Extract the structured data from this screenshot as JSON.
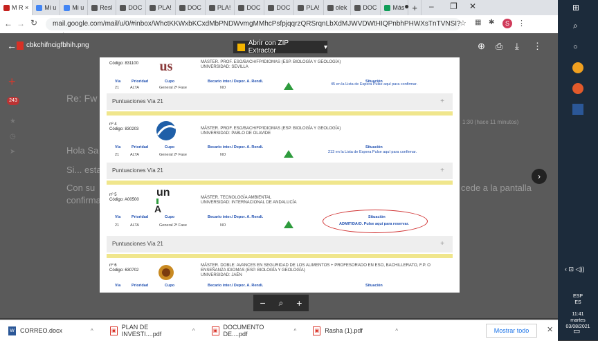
{
  "browser": {
    "tabs": [
      {
        "label": "M R ×",
        "color": "#c5221f"
      },
      {
        "label": "Mi u",
        "color": "#4285f4"
      },
      {
        "label": "Mi u",
        "color": "#4285f4"
      },
      {
        "label": "Resl",
        "color": "#555555"
      },
      {
        "label": "DOC",
        "color": "#555555"
      },
      {
        "label": "PLA!",
        "color": "#555555"
      },
      {
        "label": "DOC",
        "color": "#555555"
      },
      {
        "label": "PLA!",
        "color": "#555555"
      },
      {
        "label": "DOC",
        "color": "#555555"
      },
      {
        "label": "DOC",
        "color": "#555555"
      },
      {
        "label": "PLA!",
        "color": "#555555"
      },
      {
        "label": "olek",
        "color": "#555555"
      },
      {
        "label": "DOC",
        "color": "#555555"
      },
      {
        "label": "Más",
        "color": "#0f9d58"
      }
    ],
    "url": "mail.google.com/mail/u/0/#inbox/WhctKKWxbKCxdMbPNDWvmgMMhcPsfpjqqrzQRSrqnLbXdMJWVDWtHIQPnbhPHWXsTnTVNSI?projector=1"
  },
  "gmail_bg": {
    "subject": "Re: Fw",
    "line1": "Hola Sa",
    "line2": "Si... esta",
    "line3": "Con su",
    "line4": "confirma",
    "right_text": "cede a la pantalla",
    "date_right": "1:30 (hace 11 minutos)"
  },
  "viewer": {
    "filename": "cbkchifncigfbhih.png",
    "zip_button": "Abrir con ZIP Extractor"
  },
  "doc": {
    "entries": [
      {
        "num": "",
        "code": "Código: 831100",
        "title": "MÁSTER. PROF. ESO/BACH/FP/IDIOMAS (ESP. BIOLOGÍA Y GEOLOGÍA)",
        "univ": "UNIVERSIDAD: SEVILLA",
        "via": "21",
        "prioridad": "ALTA",
        "cupo": "General 2ª Fase",
        "becario": "NO",
        "situacion": "45 en la Lista de Espera Pulse aquí para confirmar.",
        "logo": "us"
      },
      {
        "num": "nº 4",
        "code": "Código: 830203",
        "title": "MÁSTER. PROF. ESO/BACH/FP/IDIOMAS (ESP. BIOLOGÍA Y GEOLOGÍA)",
        "univ": "UNIVERSIDAD: PABLO DE OLAVIDE",
        "via": "21",
        "prioridad": "ALTA",
        "cupo": "General 2ª Fase",
        "becario": "NO",
        "situacion": "213 en la Lista de Espera Pulse aquí para confirmar.",
        "logo": "upo"
      },
      {
        "num": "nº 5",
        "code": "Código: A00500",
        "title": "MÁSTER. TECNOLOGÍA AMBIENTAL",
        "univ": "UNIVERSIDAD: INTERNACIONAL DE ANDALUCÍA",
        "via": "21",
        "prioridad": "ALTA",
        "cupo": "General 2ª Fase",
        "becario": "NO",
        "situacion": "ADMITIDA/O. Pulse aquí para reservar.",
        "logo": "unia"
      },
      {
        "num": "nº 6",
        "code": "Código: 630702",
        "title": "MÁSTER. DOBLE: AVANCES EN SEGURIDAD DE LOS ALIMENTOS + PROFESORADO EN ESO, BACHILLERATO, F.P. O ENSEÑANZA IDIOMAS (ESP. BIOLOGÍA Y GEOLOGÍA)",
        "univ": "UNIVERSIDAD: JAÉN",
        "logo": "uja"
      }
    ],
    "headers": {
      "via": "Vía",
      "prioridad": "Prioridad",
      "cupo": "Cupo",
      "becario": "Becario inter./ Depor. A. Rendi.",
      "situacion": "Situación"
    },
    "punt_label": "Puntuaciones Vía 21",
    "logo_texts": {
      "us": "us",
      "unia_top": "un",
      "unia_bottom": "A"
    }
  },
  "downloads": [
    {
      "name": "CORREO.docx",
      "type": "word"
    },
    {
      "name": "PLAN DE INVESTI....pdf",
      "type": "pdf"
    },
    {
      "name": "DOCUMENTO DE....pdf",
      "type": "pdf"
    },
    {
      "name": "Rasha (1).pdf",
      "type": "pdf"
    }
  ],
  "show_all": "Mostrar todo",
  "clock": {
    "lang": "ESP",
    "lang2": "ES",
    "time": "11:41",
    "day": "martes",
    "date": "03/08/2021"
  }
}
